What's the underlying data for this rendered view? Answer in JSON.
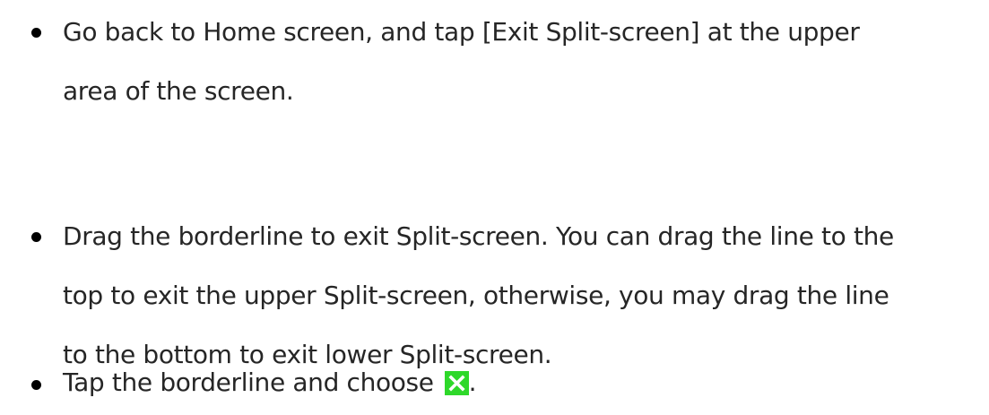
{
  "bullets": [
    {
      "lines": [
        "Go back to Home screen, and tap [Exit Split-screen] at the upper",
        "area of the screen."
      ]
    },
    {
      "lines": [
        "Drag the borderline to exit Split-screen. You can drag the line to the",
        "top to exit the upper Split-screen, otherwise, you may drag the line",
        "to the bottom to exit lower Split-screen."
      ]
    },
    {
      "lines": [
        "Tap the borderline and choose"
      ],
      "icon": "close-icon",
      "icon_color": "#2ed82a",
      "trailing": "."
    }
  ]
}
